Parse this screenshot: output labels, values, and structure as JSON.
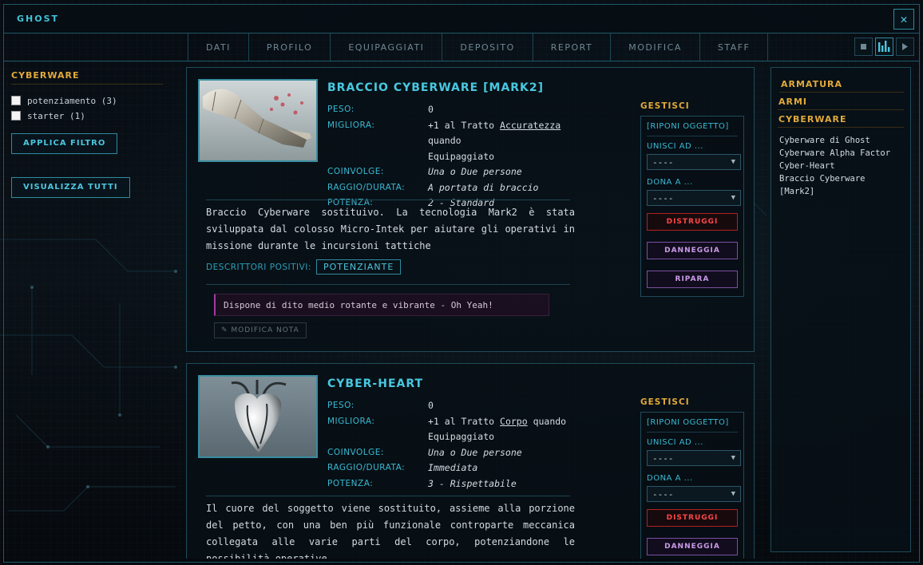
{
  "window": {
    "title": "GHOST",
    "close_icon": "✕"
  },
  "tabs": [
    "DATI",
    "PROFILO",
    "EQUIPAGGIATI",
    "DEPOSITO",
    "REPORT",
    "MODIFICA",
    "STAFF"
  ],
  "view_buttons": [
    "stop-icon",
    "bars-icon",
    "play-icon"
  ],
  "filter": {
    "heading": "CYBERWARE",
    "options": [
      {
        "label": "potenziamento (3)",
        "checked": false
      },
      {
        "label": "starter (1)",
        "checked": false
      }
    ],
    "apply_label": "APPLICA FILTRO",
    "show_all_label": "VISUALIZZA TUTTI"
  },
  "stat_labels": {
    "peso": "PESO:",
    "migliora": "MIGLIORA:",
    "coinvolge": "COINVOLGE:",
    "raggio": "RAGGIO/DURATA:",
    "potenza": "POTENZA:"
  },
  "manage": {
    "heading": "GESTISCI",
    "store": "[RIPONI OGGETTO]",
    "merge_label": "UNISCI AD ...",
    "merge_value": "----",
    "give_label": "DONA A ...",
    "give_value": "----",
    "destroy": "DISTRUGGI",
    "damage": "DANNEGGIA",
    "repair": "RIPARA"
  },
  "items": [
    {
      "name": "BRACCIO CYBERWARE [MARK2]",
      "peso": "0",
      "migliora_pre": "+1 al Tratto ",
      "migliora_trait": "Accuratezza",
      "migliora_post": " quando",
      "migliora_line2": "Equipaggiato",
      "coinvolge": "Una o Due persone",
      "raggio": "A portata di braccio",
      "potenza": "2 - Standard",
      "description": "Braccio Cyberware sostituivo. La tecnologia Mark2 è stata sviluppata dal colosso Micro-Intek per aiutare gli operativi in missione durante le incursioni tattiche",
      "descriptors_label": "DESCRITTORI POSITIVI:",
      "descriptor": "POTENZIANTE",
      "note": "Dispone di dito medio rotante e vibrante - Oh Yeah!",
      "note_button": "MODIFICA NOTA"
    },
    {
      "name": "CYBER-HEART",
      "peso": "0",
      "migliora_pre": "+1 al Tratto ",
      "migliora_trait": "Corpo",
      "migliora_post": " quando",
      "migliora_line2": "Equipaggiato",
      "coinvolge": "Una o Due persone",
      "raggio": "Immediata",
      "potenza": "3 - Rispettabile",
      "description": "Il cuore del soggetto viene sostituito, assieme alla porzione del petto, con una ben più funzionale controparte meccanica collegata alle varie parti del corpo, potenziandone le possibilità operative."
    }
  ],
  "right_panel": {
    "categories": [
      "ARMATURA",
      "ARMI",
      "CYBERWARE"
    ],
    "items": [
      "Cyberware di Ghost",
      "Cyberware Alpha Factor",
      "Cyber-Heart",
      "Braccio Cyberware [Mark2]"
    ]
  },
  "colors": {
    "accent_cyan": "#3fc3d9",
    "accent_gold": "#e2a93b",
    "danger_red": "#ff4646",
    "accent_purple": "#c89be8"
  }
}
